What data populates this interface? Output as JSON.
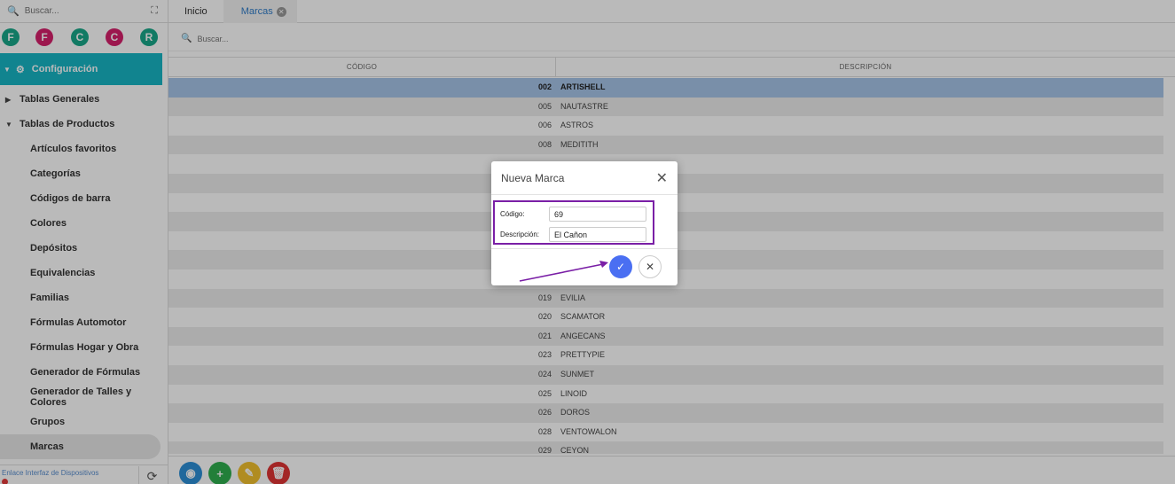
{
  "sidebar": {
    "search_placeholder": "Buscar...",
    "letters": [
      {
        "label": "F",
        "color": "#1aa889"
      },
      {
        "label": "F",
        "color": "#d6206c"
      },
      {
        "label": "C",
        "color": "#1aa889"
      },
      {
        "label": "C",
        "color": "#d6206c"
      },
      {
        "label": "R",
        "color": "#1aa889"
      }
    ],
    "config_label": "Configuración",
    "menu": [
      {
        "label": "Tablas Generales",
        "level": 1,
        "caret": "▶"
      },
      {
        "label": "Tablas de Productos",
        "level": 1,
        "caret": "▼"
      },
      {
        "label": "Artículos favoritos",
        "level": 2
      },
      {
        "label": "Categorías",
        "level": 2
      },
      {
        "label": "Códigos de barra",
        "level": 2
      },
      {
        "label": "Colores",
        "level": 2
      },
      {
        "label": "Depósitos",
        "level": 2
      },
      {
        "label": "Equivalencias",
        "level": 2
      },
      {
        "label": "Familias",
        "level": 2
      },
      {
        "label": "Fórmulas Automotor",
        "level": 2
      },
      {
        "label": "Fórmulas Hogar y Obra",
        "level": 2
      },
      {
        "label": "Generador de Fórmulas",
        "level": 2
      },
      {
        "label": "Generador de Talles y Colores",
        "level": 2
      },
      {
        "label": "Grupos",
        "level": 2
      },
      {
        "label": "Marcas",
        "level": 2,
        "active": true
      }
    ],
    "footer_link": "Enlace Interfaz de Dispositivos"
  },
  "tabs": [
    {
      "label": "Inicio",
      "active": false
    },
    {
      "label": "Marcas",
      "active": true
    }
  ],
  "grid": {
    "search_placeholder": "Buscar...",
    "columns": [
      "CÓDIGO",
      "DESCRIPCIÓN"
    ],
    "rows": [
      {
        "code": "002",
        "desc": "ARTISHELL",
        "selected": true
      },
      {
        "code": "005",
        "desc": "NAUTASTRE"
      },
      {
        "code": "006",
        "desc": "ASTROS"
      },
      {
        "code": "008",
        "desc": "MEDITITH"
      },
      {
        "code": "",
        "desc": ""
      },
      {
        "code": "",
        "desc": ""
      },
      {
        "code": "",
        "desc": ""
      },
      {
        "code": "",
        "desc": ""
      },
      {
        "code": "",
        "desc": ""
      },
      {
        "code": "",
        "desc": ""
      },
      {
        "code": "",
        "desc": ""
      },
      {
        "code": "019",
        "desc": "EVILIA"
      },
      {
        "code": "020",
        "desc": "SCAMATOR"
      },
      {
        "code": "021",
        "desc": "ANGECANS"
      },
      {
        "code": "023",
        "desc": "PRETTYPIE"
      },
      {
        "code": "024",
        "desc": "SUNMET"
      },
      {
        "code": "025",
        "desc": "LINOID"
      },
      {
        "code": "026",
        "desc": "DOROS"
      },
      {
        "code": "028",
        "desc": "VENTOWALON"
      },
      {
        "code": "029",
        "desc": "CEYON"
      }
    ]
  },
  "toolbar": {
    "buttons": [
      {
        "name": "view-button",
        "icon": "eye-icon",
        "glyph": "◉",
        "color": "#2d8fd6"
      },
      {
        "name": "add-button",
        "icon": "plus-icon",
        "glyph": "+",
        "color": "#2fae4f"
      },
      {
        "name": "edit-button",
        "icon": "pencil-icon",
        "glyph": "✎",
        "color": "#f2c12e"
      },
      {
        "name": "delete-button",
        "icon": "trash-icon",
        "glyph": "🗑",
        "color": "#e03535"
      }
    ]
  },
  "modal": {
    "title": "Nueva Marca",
    "code_label": "Código:",
    "code_value": "69",
    "desc_label": "Descripción:",
    "desc_value": "El Cañon"
  },
  "colors": {
    "accent": "#18b5c4",
    "selected_row": "#a7c4e8",
    "confirm": "#4a6ff2",
    "highlight": "#7a1fa6"
  }
}
